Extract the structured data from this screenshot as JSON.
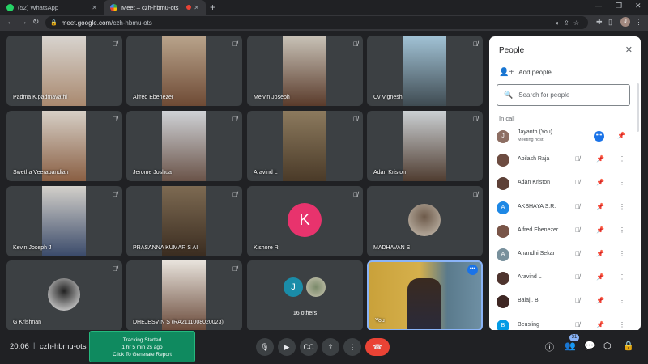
{
  "browser": {
    "tabs": [
      {
        "title": "(52) WhatsApp",
        "active": false
      },
      {
        "title": "Meet – czh-hbmu-ots",
        "active": true
      }
    ],
    "url_host": "meet.google.com",
    "url_path": "/czh-hbmu-ots",
    "profile_initial": "J"
  },
  "tiles": [
    {
      "name": "Padma K.padmavathi",
      "type": "video"
    },
    {
      "name": "Alfred Ebenezer",
      "type": "video"
    },
    {
      "name": "Melvin Joseph",
      "type": "video"
    },
    {
      "name": "Cv Vignesh",
      "type": "video"
    },
    {
      "name": "Swetha Veerapandian",
      "type": "video"
    },
    {
      "name": "Jerome Joshua",
      "type": "video"
    },
    {
      "name": "Aravind L",
      "type": "video"
    },
    {
      "name": "Adan Kriston",
      "type": "video"
    },
    {
      "name": "Kevin Joseph J",
      "type": "video"
    },
    {
      "name": "PRASANNA KUMAR S AI",
      "type": "video"
    },
    {
      "name": "Kishore R",
      "type": "avatar",
      "initial": "K"
    },
    {
      "name": "MADHAVAN S",
      "type": "photo"
    },
    {
      "name": "G Krishnan",
      "type": "photo"
    },
    {
      "name": "DHEJESVIN S (RA2111008020023)",
      "type": "video"
    },
    {
      "name": "",
      "type": "others",
      "initial": "J",
      "others_label": "16 others"
    },
    {
      "name": "You",
      "type": "self"
    }
  ],
  "bottom_bar": {
    "time": "20:06",
    "separator": "|",
    "meeting_code": "czh-hbmu-ots",
    "tracking": {
      "line1": "Tracking Started",
      "line2": "1 hr 5 min 2s ago",
      "line3": "Click To Generate Report"
    },
    "participant_count": "31"
  },
  "people_panel": {
    "title": "People",
    "add_people": "Add people",
    "search_placeholder": "Search for people",
    "section_label": "In call",
    "participants": [
      {
        "name": "Jayanth (You)",
        "subtitle": "Meeting host",
        "avatar_color": "#8d6e63",
        "initial": "J"
      },
      {
        "name": "Abilash Raja",
        "avatar_color": "#6d4c41",
        "initial": ""
      },
      {
        "name": "Adan Kriston",
        "avatar_color": "#5d4037",
        "initial": ""
      },
      {
        "name": "AKSHAYA S.R.",
        "avatar_color": "#1e88e5",
        "initial": "A"
      },
      {
        "name": "Alfred Ebenezer",
        "avatar_color": "#795548",
        "initial": ""
      },
      {
        "name": "Anandhi Sekar",
        "avatar_color": "#78909c",
        "initial": "A"
      },
      {
        "name": "Aravind L",
        "avatar_color": "#4e342e",
        "initial": ""
      },
      {
        "name": "Balaji. B",
        "avatar_color": "#3e2723",
        "initial": ""
      },
      {
        "name": "Beusling",
        "avatar_color": "#039be5",
        "initial": "B"
      }
    ]
  },
  "colors": {
    "accent": "#1a73e8",
    "end_call": "#ea4335",
    "kishore_avatar": "#e8336d",
    "tracking_bg": "#0f8a5f"
  }
}
